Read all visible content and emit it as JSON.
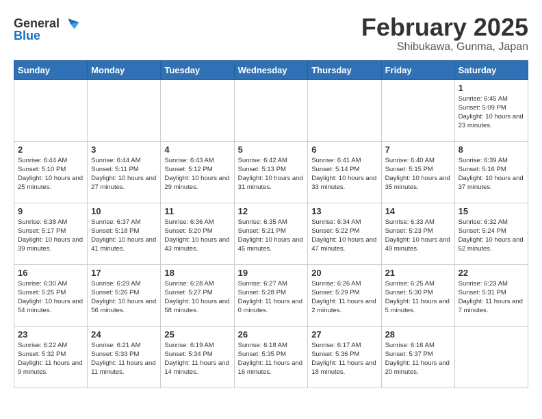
{
  "header": {
    "logo_general": "General",
    "logo_blue": "Blue",
    "month": "February 2025",
    "location": "Shibukawa, Gunma, Japan"
  },
  "weekdays": [
    "Sunday",
    "Monday",
    "Tuesday",
    "Wednesday",
    "Thursday",
    "Friday",
    "Saturday"
  ],
  "weeks": [
    [
      {
        "day": "",
        "info": ""
      },
      {
        "day": "",
        "info": ""
      },
      {
        "day": "",
        "info": ""
      },
      {
        "day": "",
        "info": ""
      },
      {
        "day": "",
        "info": ""
      },
      {
        "day": "",
        "info": ""
      },
      {
        "day": "1",
        "info": "Sunrise: 6:45 AM\nSunset: 5:09 PM\nDaylight: 10 hours and 23 minutes."
      }
    ],
    [
      {
        "day": "2",
        "info": "Sunrise: 6:44 AM\nSunset: 5:10 PM\nDaylight: 10 hours and 25 minutes."
      },
      {
        "day": "3",
        "info": "Sunrise: 6:44 AM\nSunset: 5:11 PM\nDaylight: 10 hours and 27 minutes."
      },
      {
        "day": "4",
        "info": "Sunrise: 6:43 AM\nSunset: 5:12 PM\nDaylight: 10 hours and 29 minutes."
      },
      {
        "day": "5",
        "info": "Sunrise: 6:42 AM\nSunset: 5:13 PM\nDaylight: 10 hours and 31 minutes."
      },
      {
        "day": "6",
        "info": "Sunrise: 6:41 AM\nSunset: 5:14 PM\nDaylight: 10 hours and 33 minutes."
      },
      {
        "day": "7",
        "info": "Sunrise: 6:40 AM\nSunset: 5:15 PM\nDaylight: 10 hours and 35 minutes."
      },
      {
        "day": "8",
        "info": "Sunrise: 6:39 AM\nSunset: 5:16 PM\nDaylight: 10 hours and 37 minutes."
      }
    ],
    [
      {
        "day": "9",
        "info": "Sunrise: 6:38 AM\nSunset: 5:17 PM\nDaylight: 10 hours and 39 minutes."
      },
      {
        "day": "10",
        "info": "Sunrise: 6:37 AM\nSunset: 5:18 PM\nDaylight: 10 hours and 41 minutes."
      },
      {
        "day": "11",
        "info": "Sunrise: 6:36 AM\nSunset: 5:20 PM\nDaylight: 10 hours and 43 minutes."
      },
      {
        "day": "12",
        "info": "Sunrise: 6:35 AM\nSunset: 5:21 PM\nDaylight: 10 hours and 45 minutes."
      },
      {
        "day": "13",
        "info": "Sunrise: 6:34 AM\nSunset: 5:22 PM\nDaylight: 10 hours and 47 minutes."
      },
      {
        "day": "14",
        "info": "Sunrise: 6:33 AM\nSunset: 5:23 PM\nDaylight: 10 hours and 49 minutes."
      },
      {
        "day": "15",
        "info": "Sunrise: 6:32 AM\nSunset: 5:24 PM\nDaylight: 10 hours and 52 minutes."
      }
    ],
    [
      {
        "day": "16",
        "info": "Sunrise: 6:30 AM\nSunset: 5:25 PM\nDaylight: 10 hours and 54 minutes."
      },
      {
        "day": "17",
        "info": "Sunrise: 6:29 AM\nSunset: 5:26 PM\nDaylight: 10 hours and 56 minutes."
      },
      {
        "day": "18",
        "info": "Sunrise: 6:28 AM\nSunset: 5:27 PM\nDaylight: 10 hours and 58 minutes."
      },
      {
        "day": "19",
        "info": "Sunrise: 6:27 AM\nSunset: 5:28 PM\nDaylight: 11 hours and 0 minutes."
      },
      {
        "day": "20",
        "info": "Sunrise: 6:26 AM\nSunset: 5:29 PM\nDaylight: 11 hours and 2 minutes."
      },
      {
        "day": "21",
        "info": "Sunrise: 6:25 AM\nSunset: 5:30 PM\nDaylight: 11 hours and 5 minutes."
      },
      {
        "day": "22",
        "info": "Sunrise: 6:23 AM\nSunset: 5:31 PM\nDaylight: 11 hours and 7 minutes."
      }
    ],
    [
      {
        "day": "23",
        "info": "Sunrise: 6:22 AM\nSunset: 5:32 PM\nDaylight: 11 hours and 9 minutes."
      },
      {
        "day": "24",
        "info": "Sunrise: 6:21 AM\nSunset: 5:33 PM\nDaylight: 11 hours and 11 minutes."
      },
      {
        "day": "25",
        "info": "Sunrise: 6:19 AM\nSunset: 5:34 PM\nDaylight: 11 hours and 14 minutes."
      },
      {
        "day": "26",
        "info": "Sunrise: 6:18 AM\nSunset: 5:35 PM\nDaylight: 11 hours and 16 minutes."
      },
      {
        "day": "27",
        "info": "Sunrise: 6:17 AM\nSunset: 5:36 PM\nDaylight: 11 hours and 18 minutes."
      },
      {
        "day": "28",
        "info": "Sunrise: 6:16 AM\nSunset: 5:37 PM\nDaylight: 11 hours and 20 minutes."
      },
      {
        "day": "",
        "info": ""
      }
    ]
  ]
}
